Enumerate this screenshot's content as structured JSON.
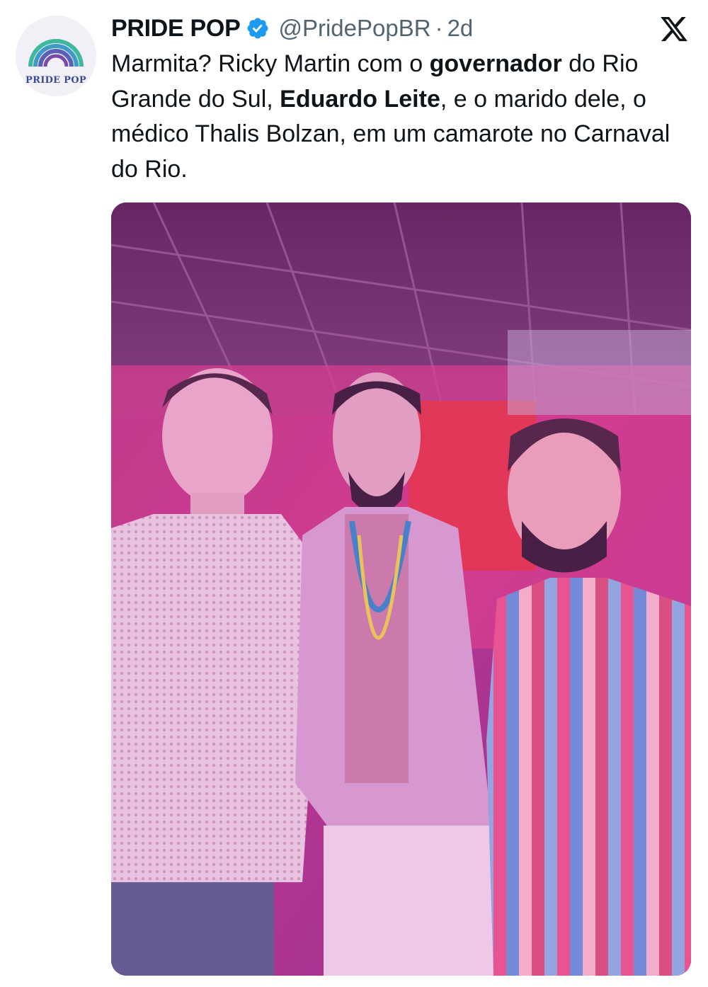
{
  "account": {
    "avatar_text": "PRIDE POP",
    "display_name": "PRIDE POP",
    "verified_icon": "verified-badge-icon",
    "handle": "@PridePopBR",
    "separator": "·",
    "time": "2d"
  },
  "platform": {
    "logo_icon": "x-logo-icon"
  },
  "tweet": {
    "t1": "Marmita? Ricky Martin com o ",
    "t2": "governador",
    "t3": " do Rio Grande do Sul, ",
    "t4": "Eduardo Leite",
    "t5": ", e o marido dele, o médico Thalis Bolzan, em um camarote no Carnaval do Rio."
  },
  "colors": {
    "text": "#0f1419",
    "secondary": "#536471",
    "verified": "#1d9bf0",
    "photo_tint": "#b03a9a"
  }
}
